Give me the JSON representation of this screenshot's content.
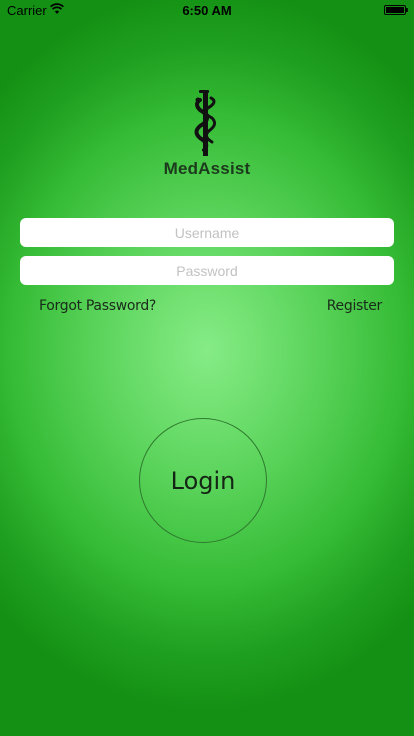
{
  "status_bar": {
    "carrier": "Carrier",
    "time": "6:50 AM",
    "wifi_icon": "wifi-icon",
    "battery_icon": "battery-full-icon"
  },
  "app": {
    "name": "MedAssist",
    "logo_icon": "caduceus-icon"
  },
  "login_form": {
    "username_placeholder": "Username",
    "username_value": "",
    "password_placeholder": "Password",
    "password_value": "",
    "forgot_password_label": "Forgot Password?",
    "register_label": "Register",
    "login_label": "Login"
  },
  "colors": {
    "background_center": "#86ec86",
    "background_edge": "#149114",
    "title_text": "#1c3a1c",
    "field_background": "#ffffff",
    "placeholder_text": "#c2c2c2",
    "login_border": "#2f7a2f"
  }
}
